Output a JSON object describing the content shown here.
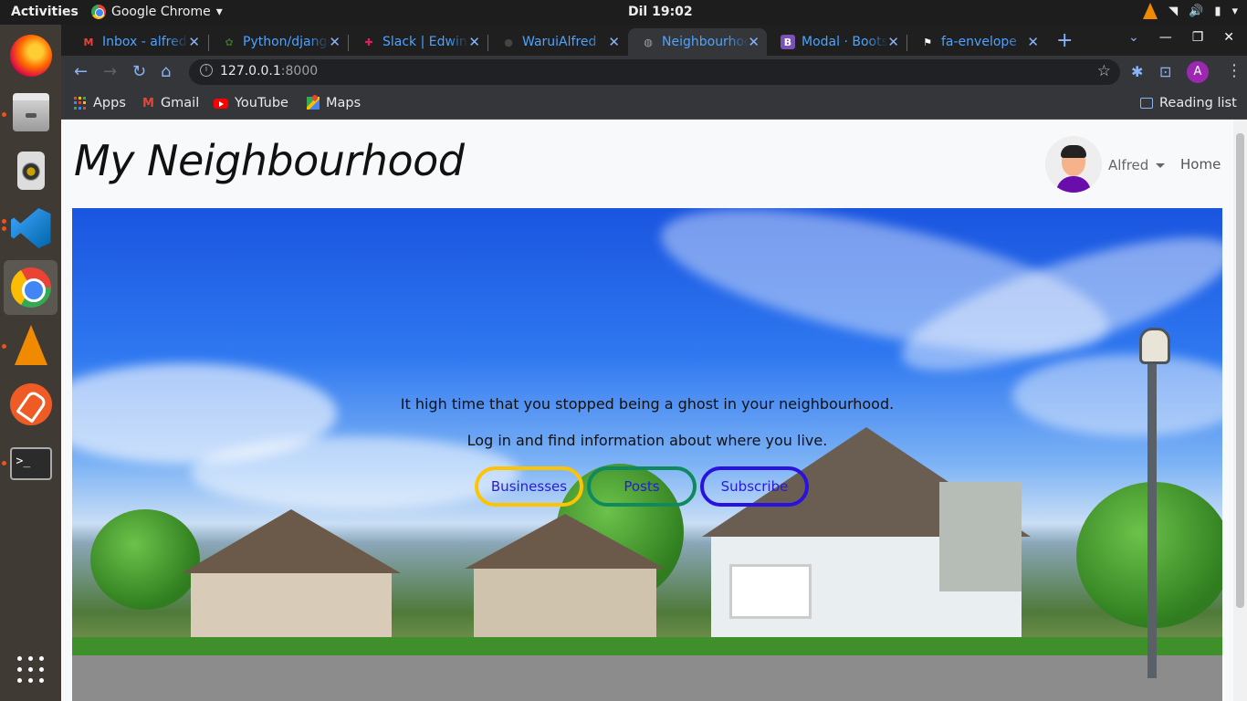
{
  "topbar": {
    "activities": "Activities",
    "app_name": "Google Chrome",
    "clock": "Dil 19:02"
  },
  "dock": {
    "apps": [
      "firefox",
      "files",
      "rhythmbox",
      "vscode",
      "chrome",
      "vlc",
      "postman",
      "terminal",
      "show-applications"
    ],
    "terminal_glyph": ">_"
  },
  "tabs": [
    {
      "title": "Inbox - alfred",
      "icon": "gmail-icon",
      "active": false
    },
    {
      "title": "Python/django",
      "icon": "github-icon",
      "active": false
    },
    {
      "title": "Slack | Edwin",
      "icon": "slack-icon",
      "active": false
    },
    {
      "title": "WaruiAlfred",
      "icon": "github-icon",
      "active": false
    },
    {
      "title": "Neighbourhood",
      "icon": "globe-icon",
      "active": true
    },
    {
      "title": "Modal · Bootstrap",
      "icon": "bootstrap-icon",
      "active": false
    },
    {
      "title": "fa-envelope",
      "icon": "flag-icon",
      "active": false
    }
  ],
  "omnibox": {
    "host": "127.0.0.1",
    "port": ":8000"
  },
  "profile_initial": "A",
  "bookmarks": {
    "apps": "Apps",
    "gmail": "Gmail",
    "youtube": "YouTube",
    "maps": "Maps",
    "reading_list": "Reading list"
  },
  "page": {
    "brand": "My Neighbourhood",
    "user": "Alfred",
    "home": "Home",
    "hero_line1": "It high time that you stopped being a ghost in your neighbourhood.",
    "hero_line2": "Log in and find information about where you live.",
    "buttons": {
      "businesses": "Businesses",
      "posts": "Posts",
      "subscribe": "Subscribe"
    }
  },
  "colors": {
    "businesses_border": "#ffc400",
    "posts_border": "#0f8a5f",
    "subscribe_border": "#2a11e0",
    "button_text": "#2a1bd6",
    "tab_text": "#4da3ff"
  }
}
